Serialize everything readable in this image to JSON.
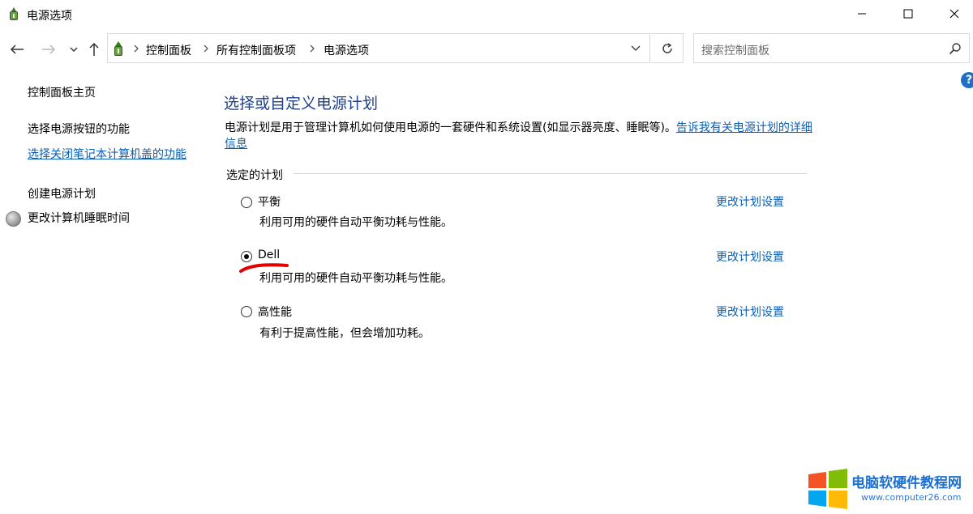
{
  "window": {
    "title": "电源选项",
    "controls": {
      "minimize": "minimize-icon",
      "maximize": "maximize-icon",
      "close": "close-icon"
    }
  },
  "nav": {
    "icons": [
      "arrow-left-icon",
      "arrow-right-icon",
      "chevron-down-icon",
      "arrow-up-icon"
    ]
  },
  "address": {
    "breadcrumbs": [
      "控制面板",
      "所有控制面板项",
      "电源选项"
    ]
  },
  "search": {
    "placeholder": "搜索控制面板"
  },
  "sidebar": {
    "items": [
      {
        "label": "控制面板主页"
      },
      {
        "label": "选择电源按钮的功能"
      },
      {
        "label": "选择关闭笔记本计算机盖的功能",
        "active": true
      },
      {
        "label": "创建电源计划"
      },
      {
        "label": "更改计算机睡眠时间"
      }
    ]
  },
  "main": {
    "title": "选择或自定义电源计划",
    "description": "电源计划是用于管理计算机如何使用电源的一套硬件和系统设置(如显示器亮度、睡眠等)。",
    "description_link": "告诉我有关电源计划的详细信息",
    "group_label": "选定的计划",
    "plans": [
      {
        "name": "平衡",
        "description": "利用可用的硬件自动平衡功耗与性能。",
        "change_label": "更改计划设置",
        "selected": false
      },
      {
        "name": "Dell",
        "description": "利用可用的硬件自动平衡功耗与性能。",
        "change_label": "更改计划设置",
        "selected": true
      },
      {
        "name": "高性能",
        "description": "有利于提高性能，但会增加功耗。",
        "change_label": "更改计划设置",
        "selected": false
      }
    ]
  },
  "watermark": {
    "title": "电脑软硬件教程网",
    "url": "www.computer26.com"
  },
  "colors": {
    "link": "#0b5fb4",
    "heading": "#1e3f8c",
    "annotation": "#e00000",
    "help": "#1e6fc6"
  }
}
